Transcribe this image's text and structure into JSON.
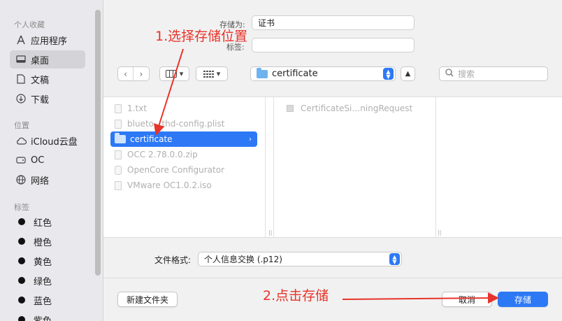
{
  "background": {
    "text_left": "…",
    "text_right": "…"
  },
  "sidebar": {
    "favorites_title": "个人收藏",
    "favorites": [
      {
        "label": "应用程序",
        "icon": "applications-icon"
      },
      {
        "label": "桌面",
        "icon": "desktop-icon",
        "selected": true
      },
      {
        "label": "文稿",
        "icon": "document-icon"
      },
      {
        "label": "下载",
        "icon": "download-icon"
      }
    ],
    "locations_title": "位置",
    "locations": [
      {
        "label": "iCloud云盘",
        "icon": "cloud-icon"
      },
      {
        "label": "OC",
        "icon": "drive-icon"
      },
      {
        "label": "网络",
        "icon": "globe-icon"
      }
    ],
    "tags_title": "标签",
    "tags": [
      {
        "label": "红色"
      },
      {
        "label": "橙色"
      },
      {
        "label": "黄色"
      },
      {
        "label": "绿色"
      },
      {
        "label": "蓝色"
      },
      {
        "label": "紫色"
      }
    ]
  },
  "save_as": {
    "label": "存储为:",
    "value": "证书"
  },
  "tags_field": {
    "label": "标签:",
    "value": ""
  },
  "toolbar": {
    "location": "certificate",
    "search_placeholder": "搜索"
  },
  "browser": {
    "column1": [
      {
        "name": "1.txt",
        "type": "file"
      },
      {
        "name": "bluetoothd-config.plist",
        "type": "file",
        "display": "blueto   thd-config.plist"
      },
      {
        "name": "certificate",
        "type": "folder",
        "selected": true
      },
      {
        "name": "OCC 2.78.0.0.zip",
        "type": "file"
      },
      {
        "name": "OpenCore Configurator",
        "type": "app"
      },
      {
        "name": "VMware OC1.0.2.iso",
        "type": "file"
      }
    ],
    "column2": [
      {
        "name": "CertificateSi…ningRequest",
        "type": "cert"
      }
    ]
  },
  "format": {
    "label": "文件格式:",
    "value": "个人信息交换 (.p12)"
  },
  "buttons": {
    "new_folder": "新建文件夹",
    "cancel": "取消",
    "save": "存储"
  },
  "annotations": {
    "step1": "1.选择存储位置",
    "step2": "2.点击存储"
  },
  "colors": {
    "accent": "#2d79f5",
    "annotation": "#e8332a"
  }
}
